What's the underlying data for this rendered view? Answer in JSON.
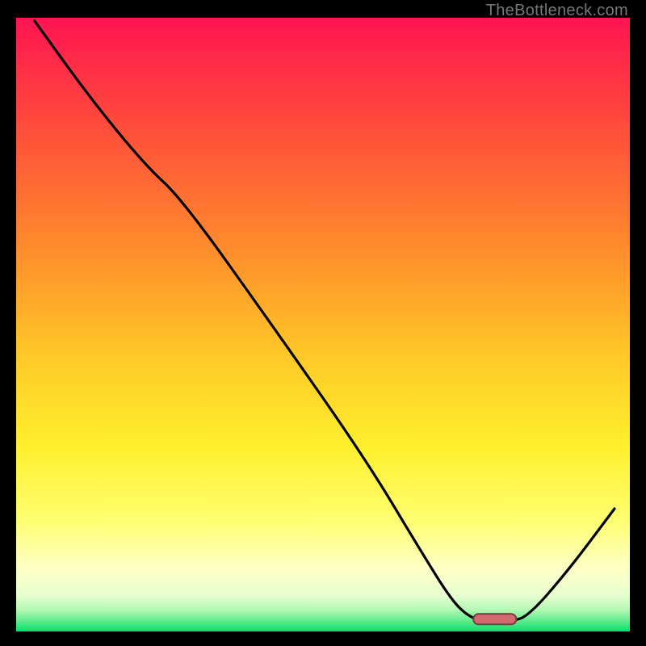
{
  "watermark": "TheBottleneck.com",
  "colors": {
    "gradient_top": "#ff1452",
    "gradient_mid1": "#ff6a2e",
    "gradient_mid2": "#ffd12a",
    "gradient_mid3": "#fff763",
    "gradient_mid4": "#fdffc6",
    "gradient_bottom": "#08df6e",
    "curve": "#000000",
    "marker_fill": "#d16a6e",
    "marker_stroke": "#7d3a3e",
    "frame": "#000000"
  },
  "chart_data": {
    "type": "line",
    "title": "",
    "xlabel": "",
    "ylabel": "",
    "xlim": [
      0,
      100
    ],
    "ylim": [
      0,
      100
    ],
    "grid": false,
    "note": "No axis ticks or labels are rendered; values are visual estimates (percent of plot area).",
    "series": [
      {
        "name": "bottleneck-curve",
        "points": [
          {
            "x": 3.0,
            "y": 99.5
          },
          {
            "x": 12.0,
            "y": 87.0
          },
          {
            "x": 21.0,
            "y": 76.0
          },
          {
            "x": 27.0,
            "y": 70.5
          },
          {
            "x": 42.0,
            "y": 49.5
          },
          {
            "x": 57.0,
            "y": 28.0
          },
          {
            "x": 66.0,
            "y": 13.0
          },
          {
            "x": 71.0,
            "y": 5.0
          },
          {
            "x": 74.0,
            "y": 2.2
          },
          {
            "x": 77.0,
            "y": 1.6
          },
          {
            "x": 80.5,
            "y": 1.6
          },
          {
            "x": 83.5,
            "y": 2.5
          },
          {
            "x": 90.0,
            "y": 10.0
          },
          {
            "x": 97.5,
            "y": 20.0
          }
        ]
      }
    ],
    "marker": {
      "x_start": 74.5,
      "x_end": 81.5,
      "y": 2.0
    }
  }
}
